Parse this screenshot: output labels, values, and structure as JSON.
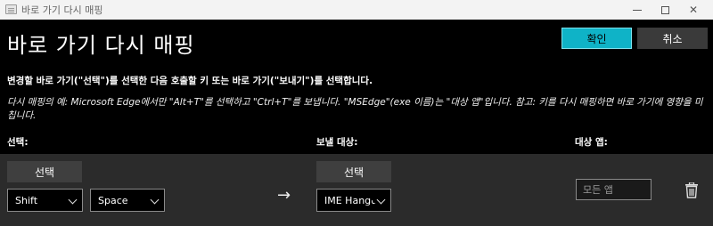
{
  "window": {
    "title": "바로 가기 다시 매핑",
    "icon": "keyboard-app-icon"
  },
  "header": {
    "title": "바로 가기 다시 매핑",
    "ok_label": "확인",
    "cancel_label": "취소",
    "accent_color": "#0fb3c7"
  },
  "instructions": {
    "main": "변경할 바로 가기(\"선택\")를 선택한 다음 호출할 키 또는 바로 가기(\"보내기\")를 선택합니다.",
    "example": "다시 매핑의 예: Microsoft Edge에서만 \"Alt+T\"를 선택하고 \"Ctrl+T\"를 보냅니다. \"MSEdge\"(exe 이름)는 \"대상 앱\"입니다. 참고: 키를 다시 매핑하면 바로 가기에 영향을 미칩니다."
  },
  "columns": {
    "select": "선택:",
    "send_to": "보낼 대상:",
    "target_app": "대상 앱:"
  },
  "row": {
    "select_button": "선택",
    "modifier": "Shift",
    "key": "Space",
    "send_button": "선택",
    "send_value": "IME Hangul",
    "app_placeholder": "모든 앱",
    "arrow": "→"
  }
}
